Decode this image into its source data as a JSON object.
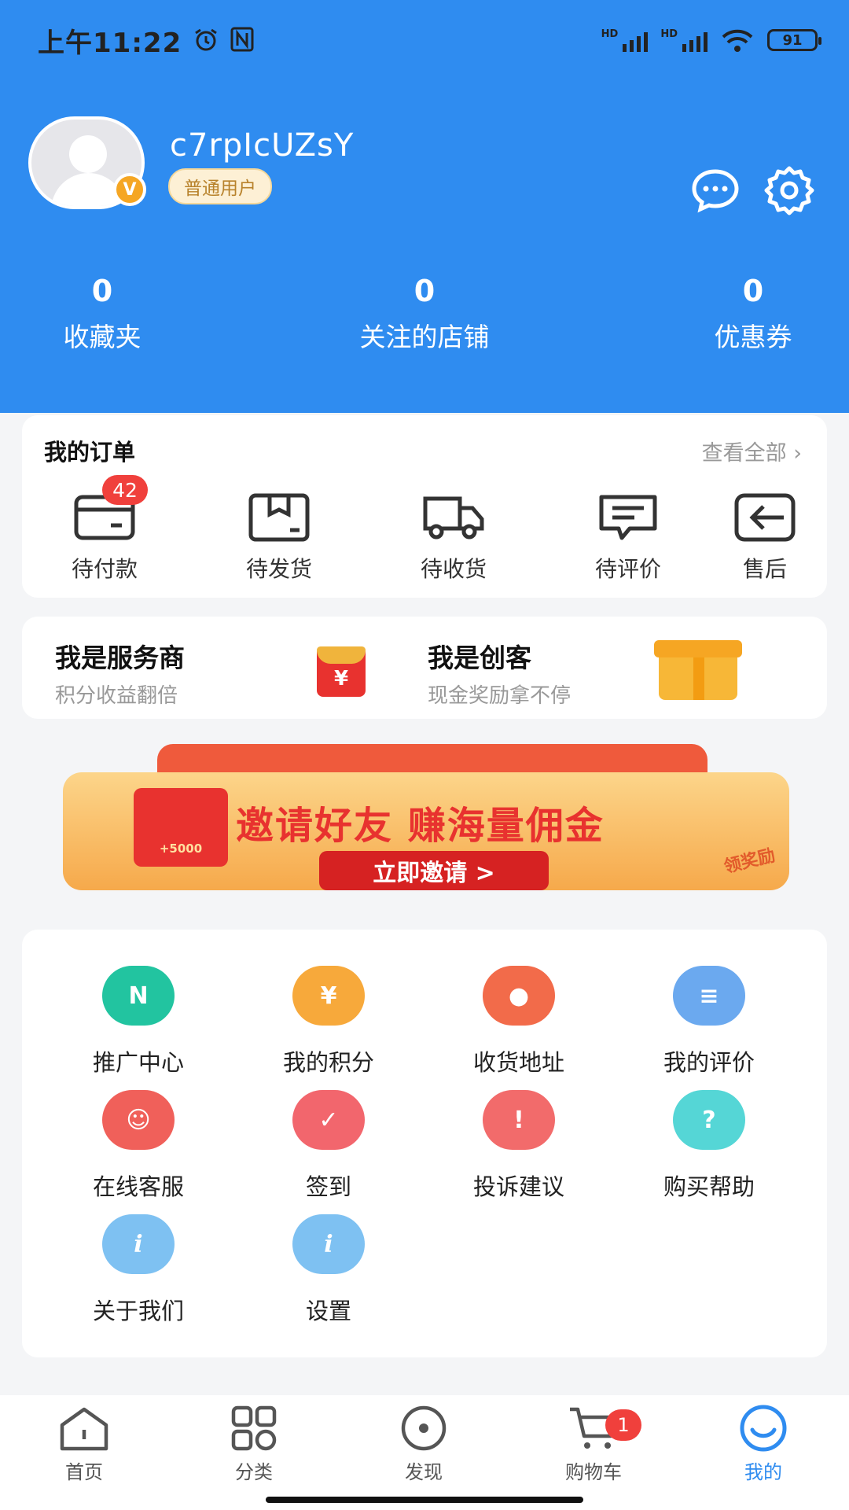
{
  "status_bar": {
    "time": "上午11:22",
    "battery": "91"
  },
  "profile": {
    "username": "c7rpIcUZsY",
    "level": "普通用户",
    "avatar_badge": "V"
  },
  "stats": [
    {
      "value": "0",
      "label": "收藏夹"
    },
    {
      "value": "0",
      "label": "关注的店铺"
    },
    {
      "value": "0",
      "label": "优惠券"
    }
  ],
  "orders": {
    "title": "我的订单",
    "view_all": "查看全部 ›",
    "items": [
      {
        "label": "待付款",
        "badge": "42",
        "icon": "wallet-icon"
      },
      {
        "label": "待发货",
        "icon": "box-icon"
      },
      {
        "label": "待收货",
        "icon": "truck-icon"
      },
      {
        "label": "待评价",
        "icon": "comment-icon"
      },
      {
        "label": "售后",
        "icon": "return-icon"
      }
    ]
  },
  "promo": {
    "left_title": "我是服务商",
    "left_sub": "积分收益翻倍",
    "left_icon_text": "¥",
    "right_title": "我是创客",
    "right_sub": "现金奖励拿不停"
  },
  "banner": {
    "title": "邀请好友 赚海量佣金",
    "button": "立即邀请 >",
    "tag": "领奖励",
    "gift_text": "+5000"
  },
  "services": [
    {
      "label": "推广中心",
      "icon": "network-icon",
      "color": "#22c4a0",
      "glyph": "N"
    },
    {
      "label": "我的积分",
      "icon": "points-icon",
      "color": "#f7a93b",
      "glyph": "¥"
    },
    {
      "label": "收货地址",
      "icon": "location-icon",
      "color": "#f26b4a",
      "glyph": "●"
    },
    {
      "label": "我的评价",
      "icon": "document-icon",
      "color": "#6ba9ef",
      "glyph": "≡"
    },
    {
      "label": "在线客服",
      "icon": "headset-icon",
      "color": "#f0605a",
      "glyph": "☺"
    },
    {
      "label": "签到",
      "icon": "calendar-icon",
      "color": "#f2666d",
      "glyph": "✓"
    },
    {
      "label": "投诉建议",
      "icon": "warning-icon",
      "color": "#f26b6b",
      "glyph": "!"
    },
    {
      "label": "购买帮助",
      "icon": "help-icon",
      "color": "#55d6d6",
      "glyph": "?"
    },
    {
      "label": "关于我们",
      "icon": "info-icon",
      "color": "#7ec1f2",
      "glyph": "i"
    },
    {
      "label": "设置",
      "icon": "info-icon",
      "color": "#7ec1f2",
      "glyph": "i"
    }
  ],
  "nav": [
    {
      "label": "首页",
      "icon": "home-icon"
    },
    {
      "label": "分类",
      "icon": "category-icon"
    },
    {
      "label": "发现",
      "icon": "discover-icon"
    },
    {
      "label": "购物车",
      "icon": "cart-icon",
      "badge": "1"
    },
    {
      "label": "我的",
      "icon": "profile-icon",
      "active": true
    }
  ],
  "colors": {
    "primary": "#2f8cf0",
    "badge": "#f0403c"
  }
}
